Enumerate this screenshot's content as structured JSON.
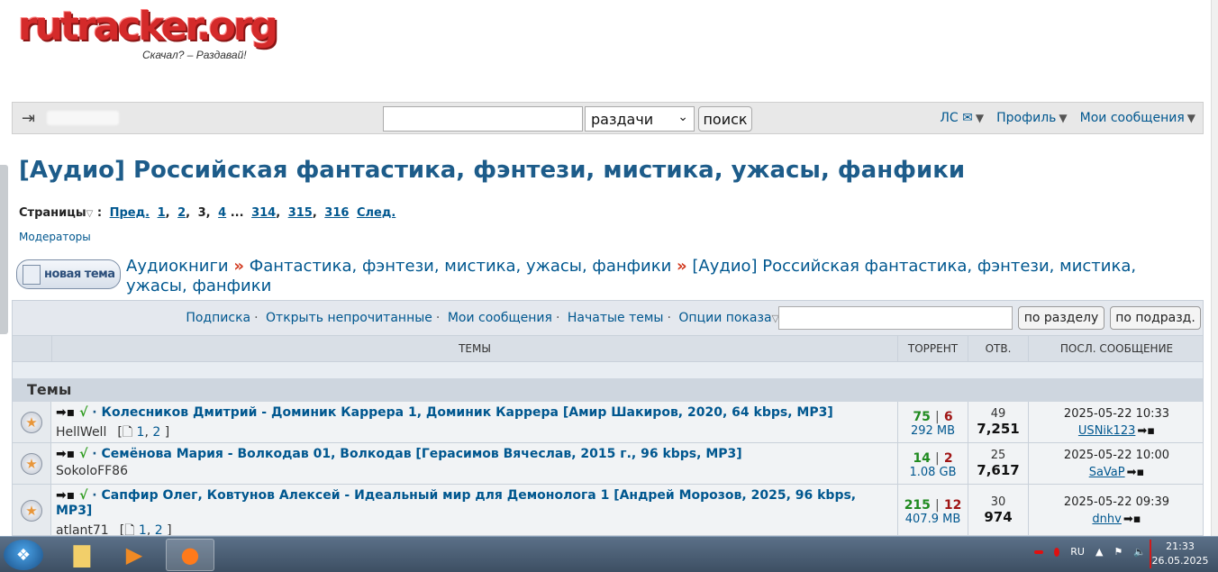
{
  "logo": {
    "text": "rutracker.org",
    "slogan": "Скачал? – Раздавай!"
  },
  "topbar": {
    "search_value": "",
    "search_scope": "раздачи",
    "search_button": "поиск",
    "links": [
      {
        "label": "ЛС",
        "icon": "mail-icon"
      },
      {
        "label": "Профиль"
      },
      {
        "label": "Мои сообщения"
      }
    ]
  },
  "forum": {
    "title": "[Аудио] Российская фантастика, фэнтези, мистика, ужасы, фанфики",
    "pages_label": "Страницы",
    "pages": {
      "prev": "Пред.",
      "items": [
        "1",
        "2",
        "3",
        "4",
        "...",
        "314",
        "315",
        "316"
      ],
      "current": "3",
      "next": "След."
    },
    "moderators": "Модераторы",
    "new_topic_button": "новая тема",
    "breadcrumb": [
      "Аудиокниги",
      "Фантастика, фэнтези, мистика, ужасы, фанфики",
      "[Аудио] Российская фантастика, фэнтези, мистика, ужасы, фанфики"
    ]
  },
  "tools": {
    "links": [
      "Подписка",
      "Открыть непрочитанные",
      "Мои сообщения",
      "Начатые темы",
      "Опции показа"
    ],
    "filter_value": "",
    "btn_section": "по разделу",
    "btn_subsection": "по подразд."
  },
  "table": {
    "headers": {
      "topics": "ТЕМЫ",
      "torrent": "ТОРРЕНТ",
      "replies": "ОТВ.",
      "last": "ПОСЛ. СООБЩЕНИЕ"
    },
    "section": "Темы",
    "rows": [
      {
        "title": "Колесников Дмитрий - Доминик Каррера 1, Доминик Каррера [Амир Шакиров, 2020, 64 kbps, MP3]",
        "author": "HellWell",
        "pages": [
          "1",
          "2"
        ],
        "seeds": "75",
        "leech": "6",
        "size": "292 MB",
        "replies": "49",
        "downloads": "7,251",
        "last_date": "2025-05-22 10:33",
        "last_user": "USNik123"
      },
      {
        "title": "Семёнова Мария - Волкодав 01, Волкодав [Герасимов Вячеслав, 2015 г., 96 kbps, MP3]",
        "author": "SokoloFF86",
        "pages": [],
        "seeds": "14",
        "leech": "2",
        "size": "1.08 GB",
        "replies": "25",
        "downloads": "7,617",
        "last_date": "2025-05-22 10:00",
        "last_user": "SaVaP"
      },
      {
        "title": "Сапфир Олег, Ковтунов Алексей - Идеальный мир для Демонолога 1 [Андрей Морозов, 2025, 96 kbps, MP3]",
        "author": "atlant71",
        "pages": [
          "1",
          "2"
        ],
        "seeds": "215",
        "leech": "12",
        "size": "407.9 MB",
        "replies": "30",
        "downloads": "974",
        "last_date": "2025-05-22 09:39",
        "last_user": "dnhv"
      }
    ]
  },
  "taskbar": {
    "lang": "RU",
    "time": "21:33",
    "date": "26.05.2025"
  }
}
